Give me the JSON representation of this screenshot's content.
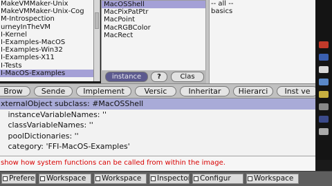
{
  "packages": {
    "items": [
      "MakeVMMaker-Unix",
      "MakeVMMaker-Unix-Cog",
      "M-Introspection",
      "urneyInTheVM",
      "I-Kernel",
      "I-Examples-MacOS",
      "I-Examples-Win32",
      "I-Examples-X11",
      "I-Tests",
      "I-MacOS-Examples"
    ],
    "selected_index": 9
  },
  "classes": {
    "items": [
      "MacOSShell",
      "MacPixPatPtr",
      "MacPoint",
      "MacRGBColor",
      "MacRect"
    ],
    "selected_index": 0,
    "buttons": [
      "instance",
      "?",
      "Clas"
    ]
  },
  "categories": {
    "items": [
      "-- all --",
      "basics"
    ]
  },
  "toolbar": {
    "buttons": [
      "Brow",
      "Sende",
      "Implement",
      "Versic",
      "Inheritar",
      "Hierarci",
      "Inst ve"
    ]
  },
  "code": {
    "lines": [
      "xternalObject subclass: #MacOSShell",
      "   instanceVariableNames: ''",
      "   classVariableNames: ''",
      "   poolDictionaries: ''",
      "   category: 'FFI-MacOS-Examples'"
    ],
    "highlighted_line": 0
  },
  "comment": {
    "text": "show how system functions can be called from within the image."
  },
  "taskbar": {
    "items": [
      "Preferen",
      "Workspace",
      "Workspace",
      "Inspector",
      "Configur",
      "Workspace"
    ]
  },
  "colors": {
    "selection": "#a4a0d6",
    "code_highlight": "#a9abd8",
    "comment_text": "#d80000",
    "taskbar": "#5e5e5e"
  }
}
